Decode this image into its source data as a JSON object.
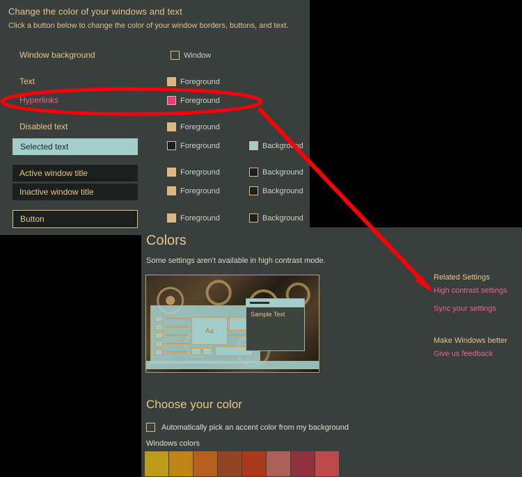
{
  "high_contrast_panel": {
    "title": "Change the color of your windows and text",
    "subtitle": "Click a button below to change the color of your window borders, buttons, and text.",
    "rows": [
      {
        "label": "Window background",
        "label_color": "#e8c48a",
        "foreground": null,
        "chips": [
          {
            "text": "Window",
            "color": "transparent"
          }
        ]
      },
      {
        "label": "Text",
        "label_color": "#e8c48a",
        "chips": [
          {
            "text": "Foreground",
            "color": "#dcb87f"
          }
        ]
      },
      {
        "label": "Hyperlinks",
        "label_color": "#ef5f94",
        "chips": [
          {
            "text": "Foreground",
            "color": "#f0387f"
          }
        ]
      },
      {
        "label": "Disabled text",
        "label_color": "#e8c48a",
        "chips": [
          {
            "text": "Foreground",
            "color": "#dcb87f"
          }
        ]
      },
      {
        "label": "Selected text",
        "label_color": "#22282a",
        "chips": [
          {
            "text": "Foreground",
            "color": "#1b1f1e"
          },
          {
            "text": "Background",
            "color": "#a3cdca"
          }
        ]
      },
      {
        "label": "Active window title",
        "label_color": "#e8c48a",
        "chips": [
          {
            "text": "Foreground",
            "color": "#dcb87f"
          },
          {
            "text": "Background",
            "color": "#1b1f1e"
          }
        ]
      },
      {
        "label": "Inactive window title",
        "label_color": "#e8c48a",
        "chips": [
          {
            "text": "Foreground",
            "color": "#dcb87f"
          },
          {
            "text": "Background",
            "color": "#1b1f1e"
          }
        ]
      },
      {
        "label": "Button",
        "label_color": "#e8c48a",
        "chips": [
          {
            "text": "Foreground",
            "color": "#dcb87f"
          },
          {
            "text": "Background",
            "color": "#1b1f1e"
          }
        ]
      }
    ],
    "sample_boxes": {
      "selected_text": "Selected text",
      "active_window_title": "Active window title",
      "inactive_window_title": "Inactive window title",
      "button": "Button"
    }
  },
  "settings": {
    "colors_heading": "Colors",
    "colors_note": "Some settings aren't available in high contrast mode.",
    "preview": {
      "sample_window_text": "Sample Text",
      "aa_label": "Aa"
    },
    "related": {
      "heading": "Related Settings",
      "links": [
        "High contrast settings",
        "Sync your settings"
      ],
      "feedback_heading": "Make Windows better",
      "feedback_link": "Give us feedback"
    },
    "choose_your_color": {
      "heading": "Choose your color",
      "auto_accent_label": "Automatically pick an accent color from my background",
      "auto_accent_checked": false,
      "windows_colors_label": "Windows colors",
      "swatches": [
        "#bd9a1a",
        "#c08316",
        "#b5601f",
        "#914523",
        "#a8391a",
        "#ab5f55",
        "#8e333e",
        "#bd4a4a"
      ]
    }
  },
  "annotations": {
    "ellipse_target": "Hyperlinks",
    "arrow_target": "High contrast settings",
    "color": "#fb0007"
  }
}
